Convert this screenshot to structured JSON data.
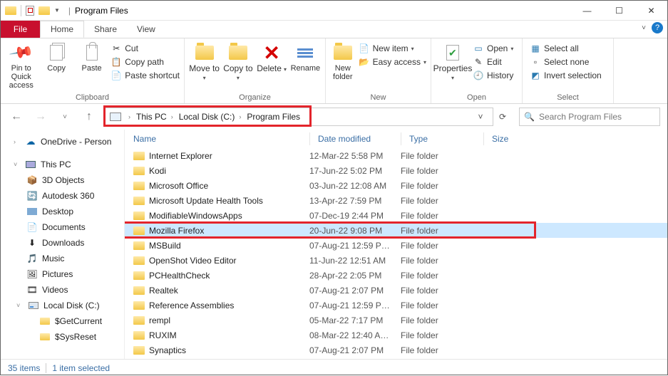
{
  "window": {
    "title": "Program Files"
  },
  "tabs": {
    "file": "File",
    "home": "Home",
    "share": "Share",
    "view": "View"
  },
  "ribbon": {
    "clipboard": {
      "label": "Clipboard",
      "pin": "Pin to Quick access",
      "copy": "Copy",
      "paste": "Paste",
      "cut": "Cut",
      "copypath": "Copy path",
      "shortcut": "Paste shortcut"
    },
    "organize": {
      "label": "Organize",
      "moveto": "Move to",
      "copyto": "Copy to",
      "delete": "Delete",
      "rename": "Rename"
    },
    "new": {
      "label": "New",
      "folder": "New folder",
      "item": "New item",
      "easy": "Easy access"
    },
    "open": {
      "label": "Open",
      "props": "Properties",
      "open": "Open",
      "edit": "Edit",
      "history": "History"
    },
    "select": {
      "label": "Select",
      "all": "Select all",
      "none": "Select none",
      "invert": "Invert selection"
    }
  },
  "breadcrumb": {
    "pc": "This PC",
    "drive": "Local Disk (C:)",
    "folder": "Program Files"
  },
  "search": {
    "placeholder": "Search Program Files"
  },
  "nav": {
    "onedrive": "OneDrive - Person",
    "thispc": "This PC",
    "items": [
      "3D Objects",
      "Autodesk 360",
      "Desktop",
      "Documents",
      "Downloads",
      "Music",
      "Pictures",
      "Videos",
      "Local Disk (C:)"
    ],
    "sub": [
      "$GetCurrent",
      "$SysReset"
    ]
  },
  "columns": {
    "name": "Name",
    "date": "Date modified",
    "type": "Type",
    "size": "Size"
  },
  "rows": [
    {
      "name": "Internet Explorer",
      "date": "12-Mar-22 5:58 PM",
      "type": "File folder"
    },
    {
      "name": "Kodi",
      "date": "17-Jun-22 5:02 PM",
      "type": "File folder"
    },
    {
      "name": "Microsoft Office",
      "date": "03-Jun-22 12:08 AM",
      "type": "File folder"
    },
    {
      "name": "Microsoft Update Health Tools",
      "date": "13-Apr-22 7:59 PM",
      "type": "File folder"
    },
    {
      "name": "ModifiableWindowsApps",
      "date": "07-Dec-19 2:44 PM",
      "type": "File folder"
    },
    {
      "name": "Mozilla Firefox",
      "date": "20-Jun-22 9:08 PM",
      "type": "File folder",
      "selected": true
    },
    {
      "name": "MSBuild",
      "date": "07-Aug-21 12:59 P…",
      "type": "File folder"
    },
    {
      "name": "OpenShot Video Editor",
      "date": "11-Jun-22 12:51 AM",
      "type": "File folder"
    },
    {
      "name": "PCHealthCheck",
      "date": "28-Apr-22 2:05 PM",
      "type": "File folder"
    },
    {
      "name": "Realtek",
      "date": "07-Aug-21 2:07 PM",
      "type": "File folder"
    },
    {
      "name": "Reference Assemblies",
      "date": "07-Aug-21 12:59 P…",
      "type": "File folder"
    },
    {
      "name": "rempl",
      "date": "05-Mar-22 7:17 PM",
      "type": "File folder"
    },
    {
      "name": "RUXIM",
      "date": "08-Mar-22 12:40 A…",
      "type": "File folder"
    },
    {
      "name": "Synaptics",
      "date": "07-Aug-21 2:07 PM",
      "type": "File folder"
    }
  ],
  "status": {
    "items": "35 items",
    "selected": "1 item selected"
  }
}
